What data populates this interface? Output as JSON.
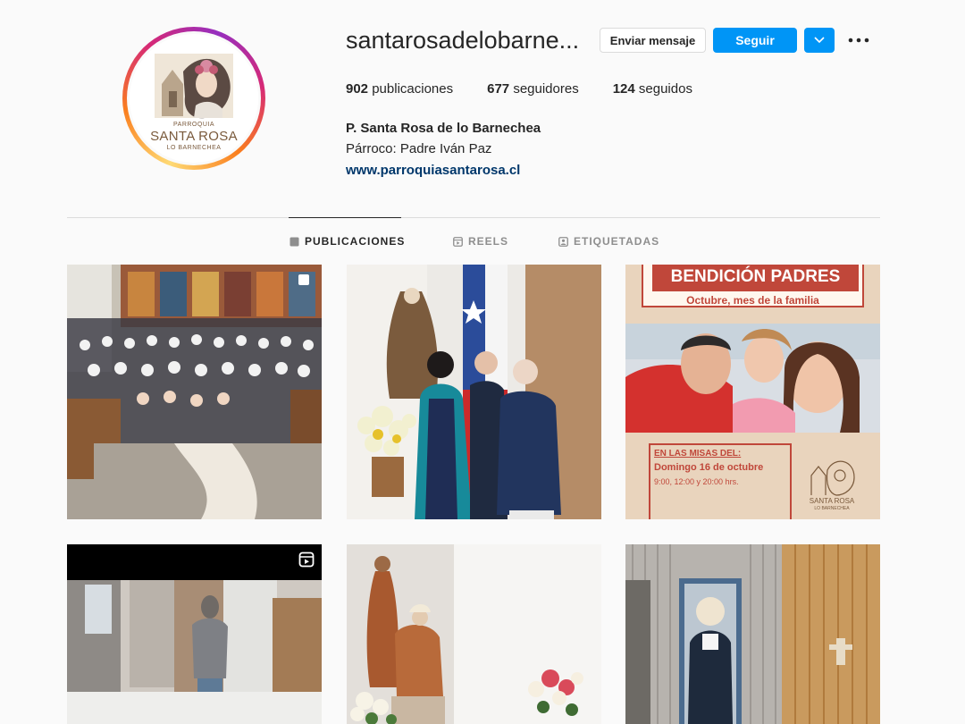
{
  "profile": {
    "username": "santarosadelobarne...",
    "full_name": "P. Santa Rosa de lo Barnechea",
    "bio": "Párroco: Padre Iván Paz",
    "website": "www.parroquiasantarosa.cl",
    "avatar": {
      "line1": "PARROQUIA",
      "line2": "SANTA ROSA",
      "line3": "LO BARNECHEA"
    }
  },
  "actions": {
    "message_label": "Enviar mensaje",
    "follow_label": "Seguir"
  },
  "stats": {
    "posts_count": "902",
    "posts_label": "publicaciones",
    "followers_count": "677",
    "followers_label": "seguidores",
    "following_count": "124",
    "following_label": "seguidos"
  },
  "tabs": [
    {
      "label": "PUBLICACIONES",
      "icon": "grid-icon",
      "active": true
    },
    {
      "label": "REELS",
      "icon": "reels-icon",
      "active": false
    },
    {
      "label": "ETIQUETADAS",
      "icon": "tagged-icon",
      "active": false
    }
  ],
  "posts": [
    {
      "id": "post-1",
      "kind": "photo",
      "description": "school children group in church",
      "badge": "multi-photo-icon"
    },
    {
      "id": "post-2",
      "kind": "photo",
      "description": "three people beside statue and chilean flag"
    },
    {
      "id": "post-3",
      "kind": "graphic",
      "header": "BENDICIÓN PADRES",
      "subheader": "Octubre, mes de la familia",
      "body_label": "EN LAS MISAS DEL:",
      "body_date": "Domingo 16 de octubre",
      "body_times": "9:00, 12:00 y 20:00 hrs.",
      "logo_line1": "SANTA ROSA",
      "logo_line2": "LO BARNECHEA"
    },
    {
      "id": "post-4",
      "kind": "reel",
      "description": "blurred person in hallway",
      "badge": "reel-icon"
    },
    {
      "id": "post-5",
      "kind": "photo",
      "description": "wooden statues with flowers"
    },
    {
      "id": "post-6",
      "kind": "photo",
      "description": "saint painting and wood wall"
    }
  ],
  "colors": {
    "follow_blue": "#0095f6",
    "link_blue": "#00376b",
    "divider": "#dbdbdb",
    "graphic_red": "#c0473a",
    "graphic_beige": "#e9d4bd"
  }
}
